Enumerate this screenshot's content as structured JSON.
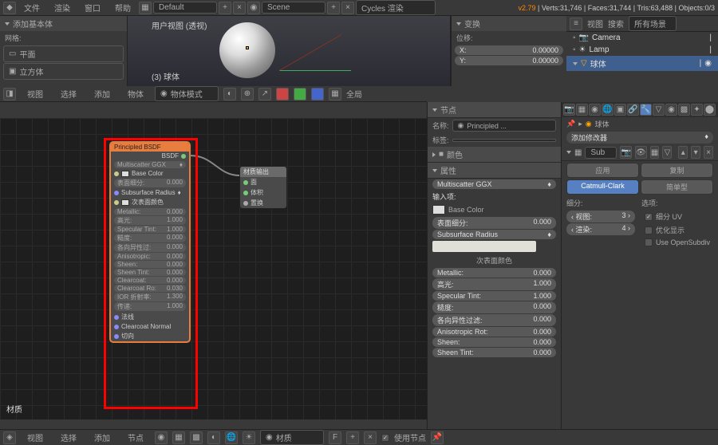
{
  "topbar": {
    "menus": [
      "文件",
      "渲染",
      "窗口",
      "帮助"
    ],
    "layout": "Default",
    "scene": "Scene",
    "engine": "Cycles 渲染",
    "version": "v2.79",
    "stats": "Verts:31,746 | Faces:31,744 | Tris:63,488 | Objects:0/3"
  },
  "add_panel": {
    "title": "添加基本体",
    "section": "网格:",
    "items": [
      "平面",
      "立方体"
    ]
  },
  "viewport": {
    "title": "用户视图 (透视)",
    "obj": "(3) 球体"
  },
  "transform": {
    "title": "变换",
    "loc": "位移:",
    "x": "X:",
    "xv": "0.00000",
    "y": "Y:",
    "yv": "0.00000"
  },
  "view3d_header": [
    "视图",
    "选择",
    "添加",
    "物体"
  ],
  "view3d_mode": "物体模式",
  "view3d_shade": "全局",
  "outliner": {
    "header": [
      "视图",
      "搜索"
    ],
    "scenes": "所有场景",
    "items": [
      "Camera",
      "Lamp",
      "球体"
    ]
  },
  "node_header": [
    "视图",
    "选择",
    "添加",
    "节点"
  ],
  "node_material": "材质",
  "node_use": "使用节点",
  "node_label": "材质",
  "principled": {
    "title": "Principled BSDF",
    "out": "BSDF",
    "distribution": "Multiscatter GGX",
    "base_color": "Base Color",
    "rows": [
      {
        "l": "表面细分:",
        "v": "0.000"
      },
      {
        "l": "Subsurface Radius",
        "v": ""
      },
      {
        "l": "次表面颜色",
        "v": ""
      },
      {
        "l": "Metallic:",
        "v": "0.000"
      },
      {
        "l": "高光:",
        "v": "1.000"
      },
      {
        "l": "Specular Tint:",
        "v": "1.000"
      },
      {
        "l": "糙度:",
        "v": "0.000"
      },
      {
        "l": "各向异性过:",
        "v": "0.000"
      },
      {
        "l": "Anisotropic:",
        "v": "0.000"
      },
      {
        "l": "Sheen:",
        "v": "0.000"
      },
      {
        "l": "Sheen Tint:",
        "v": "0.000"
      },
      {
        "l": "Clearcoat:",
        "v": "0.000"
      },
      {
        "l": "Clearcoat Ro:",
        "v": "0.030"
      },
      {
        "l": "IOR 折射率:",
        "v": "1.300"
      },
      {
        "l": "传递:",
        "v": "1.000"
      },
      {
        "l": "法线",
        "v": ""
      },
      {
        "l": "Clearcoat Normal",
        "v": ""
      },
      {
        "l": "切向",
        "v": ""
      }
    ]
  },
  "mat_output": {
    "title": "材质输出",
    "sockets": [
      "面",
      "体积",
      "置换"
    ]
  },
  "props": {
    "node_section": "节点",
    "name_l": "名称:",
    "name_v": "Principled ...",
    "label_l": "标签:",
    "color_section": "颜色",
    "attr_section": "属性",
    "distribution": "Multiscatter GGX",
    "inputs": "输入项:",
    "base_color": "Base Color",
    "rows": [
      {
        "l": "表面细分:",
        "v": "0.000"
      }
    ],
    "subsurf": "Subsurface Radius",
    "subcolor": "次表面颜色",
    "rows2": [
      {
        "l": "Metallic:",
        "v": "0.000"
      },
      {
        "l": "高光:",
        "v": "1.000"
      },
      {
        "l": "Specular Tint:",
        "v": "1.000"
      },
      {
        "l": "糙度:",
        "v": "0.000"
      },
      {
        "l": "各向异性过滤:",
        "v": "0.000"
      },
      {
        "l": "Anisotropic Rot:",
        "v": "0.000"
      },
      {
        "l": "Sheen:",
        "v": "0.000"
      },
      {
        "l": "Sheen Tint:",
        "v": "0.000"
      }
    ]
  },
  "modifier": {
    "obj": "球体",
    "add": "添加修改器",
    "name": "Sub",
    "apply": "应用",
    "copy": "复制",
    "catmull": "Catmull-Clark",
    "simple": "简单型",
    "subdiv": "细分:",
    "options": "选项:",
    "view_l": "视图:",
    "view_v": "3",
    "render_l": "渲染:",
    "render_v": "4",
    "subdiv_uv": "细分 UV",
    "optimal": "优化显示",
    "opensubdiv": "Use OpenSubdiv"
  }
}
